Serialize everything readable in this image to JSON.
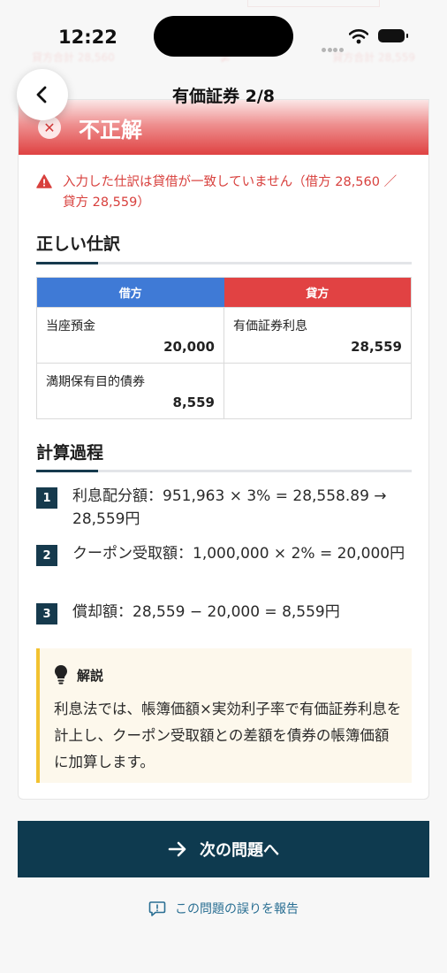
{
  "status_bar": {
    "time": "12:22"
  },
  "background_echo": {
    "left": "貸方合計 28,560",
    "mid": "≠",
    "right": "貸方合計 28,559"
  },
  "nav": {
    "title": "有価証券  2/8"
  },
  "result": {
    "verdict": "不正解",
    "error_message": "入力した仕訳は貸借が一致していません（借方 28,560 ／ 貸方 28,559）"
  },
  "journal": {
    "section_title": "正しい仕訳",
    "debit_header": "借方",
    "credit_header": "貸方",
    "rows": [
      {
        "debit_account": "当座預金",
        "debit_amount": "20,000",
        "credit_account": "有価証券利息",
        "credit_amount": "28,559"
      },
      {
        "debit_account": "満期保有目的債券",
        "debit_amount": "8,559",
        "credit_account": "",
        "credit_amount": ""
      }
    ]
  },
  "calculation": {
    "section_title": "計算過程",
    "steps": [
      {
        "num": "1",
        "text": "利息配分額：951,963 × 3% = 28,558.89 → 28,559円"
      },
      {
        "num": "2",
        "text": "クーポン受取額：1,000,000 × 2% = 20,000円"
      },
      {
        "num": "3",
        "text": "償却額：28,559 − 20,000 = 8,559円"
      }
    ]
  },
  "explanation": {
    "title": "解説",
    "text": "利息法では、帳簿価額×実効利子率で有価証券利息を計上し、クーポン受取額との差額を債券の帳簿価額に加算します。"
  },
  "actions": {
    "next_label": "次の問題へ",
    "report_label": "この問題の誤りを報告"
  },
  "colors": {
    "primary": "#0e3a4f",
    "debit": "#3f7ad6",
    "credit": "#e14243",
    "error": "#d8403d",
    "highlight": "#f2c230"
  },
  "icons": {
    "back": "chevron-left-icon",
    "verdict": "x-circle-icon",
    "error": "warning-triangle-icon",
    "explain": "lightbulb-icon",
    "next": "arrow-right-icon",
    "report": "report-bubble-icon"
  }
}
